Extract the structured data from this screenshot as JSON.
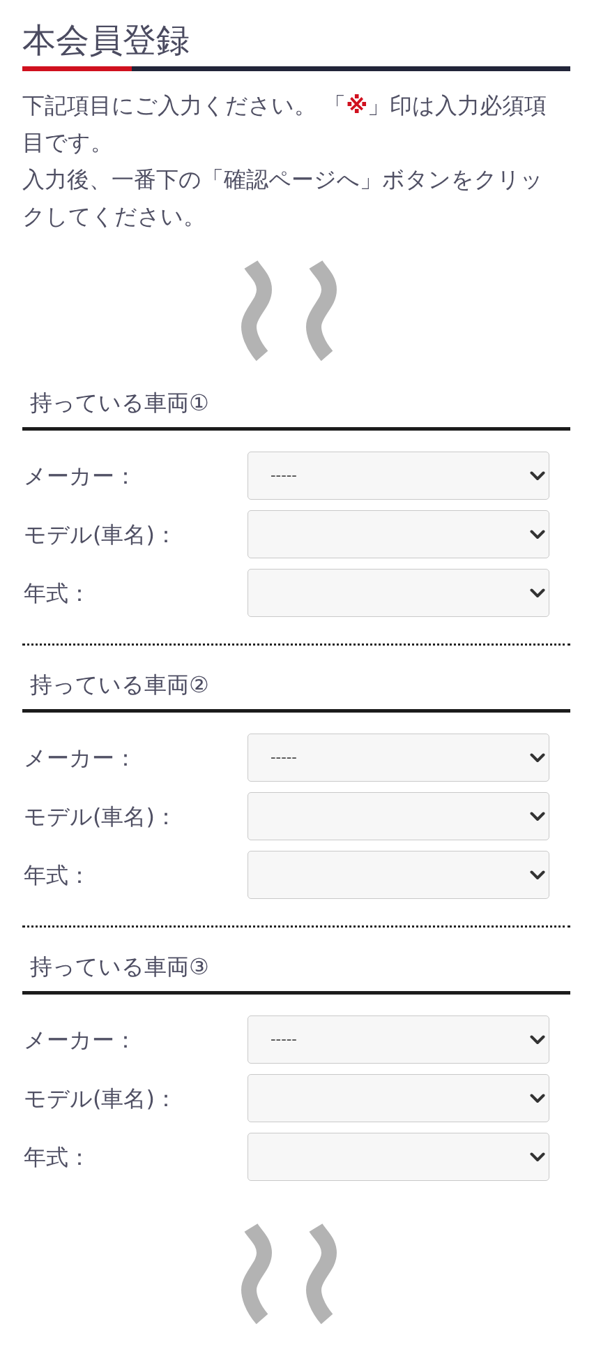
{
  "page_title": "本会員登録",
  "intro": [
    {
      "segments": [
        {
          "kind": "text",
          "text": "下記項目にご入力ください。 「"
        },
        {
          "kind": "required_mark",
          "text": "※"
        },
        {
          "kind": "text",
          "text": "」印は入力必須項目です。"
        }
      ]
    },
    {
      "segments": [
        {
          "kind": "text",
          "text": "入力後、一番下の「確認ページへ」ボタンをクリックしてください。"
        }
      ]
    }
  ],
  "vehicles": [
    {
      "heading": "持っている車両①",
      "fields": [
        {
          "label": "メーカー：",
          "value": "-----"
        },
        {
          "label": "モデル(車名)："
        },
        {
          "label": "年式："
        }
      ]
    },
    {
      "heading": "持っている車両②",
      "fields": [
        {
          "label": "メーカー：",
          "value": "-----"
        },
        {
          "label": "モデル(車名)："
        },
        {
          "label": "年式："
        }
      ]
    },
    {
      "heading": "持っている車両③",
      "fields": [
        {
          "label": "メーカー：",
          "value": "-----"
        },
        {
          "label": "モデル(車名)："
        },
        {
          "label": "年式："
        }
      ]
    }
  ]
}
